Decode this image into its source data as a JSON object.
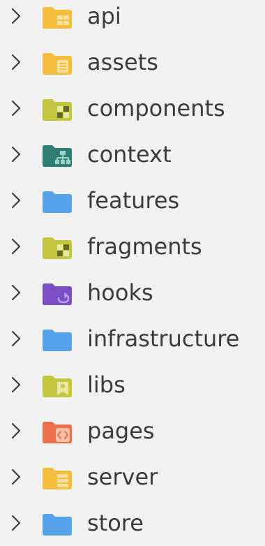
{
  "explorer": {
    "folders": [
      {
        "name": "api",
        "icon": "folder-api-icon",
        "color": "#f4bd3c",
        "accent": "#fbe1a0"
      },
      {
        "name": "assets",
        "icon": "folder-assets-icon",
        "color": "#f4bd3c",
        "accent": "#fbe1a0"
      },
      {
        "name": "components",
        "icon": "folder-components-icon",
        "color": "#c4c73e",
        "accent": "#e6e8a3"
      },
      {
        "name": "context",
        "icon": "folder-context-icon",
        "color": "#2f7f74",
        "accent": "#9fd2c7"
      },
      {
        "name": "features",
        "icon": "folder-icon",
        "color": "#56a3ec",
        "accent": "#8cc2f3"
      },
      {
        "name": "fragments",
        "icon": "folder-fragments-icon",
        "color": "#c4c73e",
        "accent": "#e6e8a3"
      },
      {
        "name": "hooks",
        "icon": "folder-hooks-icon",
        "color": "#7a4fc6",
        "accent": "#b9a1ea"
      },
      {
        "name": "infrastructure",
        "icon": "folder-icon",
        "color": "#56a3ec",
        "accent": "#8cc2f3"
      },
      {
        "name": "libs",
        "icon": "folder-libs-icon",
        "color": "#c4c73e",
        "accent": "#e6e8a3"
      },
      {
        "name": "pages",
        "icon": "folder-pages-icon",
        "color": "#ec6f49",
        "accent": "#f7c0ad"
      },
      {
        "name": "server",
        "icon": "folder-server-icon",
        "color": "#f4bd3c",
        "accent": "#fbe1a0"
      },
      {
        "name": "store",
        "icon": "folder-icon",
        "color": "#56a3ec",
        "accent": "#8cc2f3"
      }
    ]
  }
}
